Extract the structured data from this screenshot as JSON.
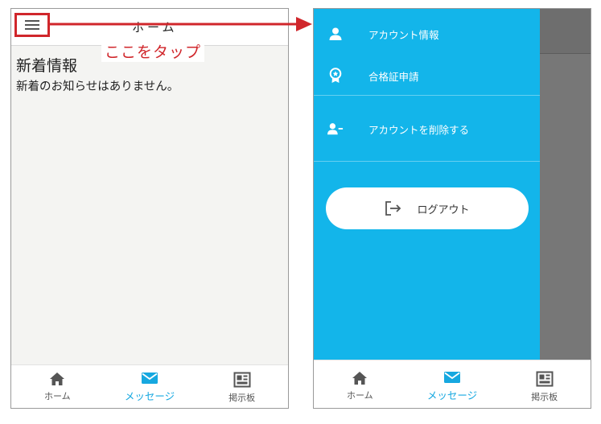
{
  "left_screen": {
    "header": {
      "title": "ホーム"
    },
    "content": {
      "title": "新着情報",
      "message": "新着のお知らせはありません。"
    },
    "tabs": [
      {
        "label": "ホーム",
        "icon": "home-icon",
        "active": false
      },
      {
        "label": "メッセージ",
        "icon": "mail-icon",
        "active": true
      },
      {
        "label": "掲示板",
        "icon": "board-icon",
        "active": false
      }
    ]
  },
  "annotation": {
    "tap_note": "ここをタップ",
    "color": "#d0262b"
  },
  "drawer": {
    "items": [
      {
        "label": "アカウント情報",
        "icon": "person-icon"
      },
      {
        "label": "合格証申請",
        "icon": "award-ribbon-icon"
      },
      {
        "label": "アカウントを削除する",
        "icon": "person-remove-icon"
      }
    ],
    "logout": {
      "label": "ログアウト",
      "icon": "logout-icon"
    },
    "color": "#13b5ea"
  },
  "right_screen": {
    "tabs": [
      {
        "label": "ホーム",
        "icon": "home-icon",
        "active": false
      },
      {
        "label": "メッセージ",
        "icon": "mail-icon",
        "active": true
      },
      {
        "label": "掲示板",
        "icon": "board-icon",
        "active": false
      }
    ]
  },
  "accent_color": "#16a8e0"
}
